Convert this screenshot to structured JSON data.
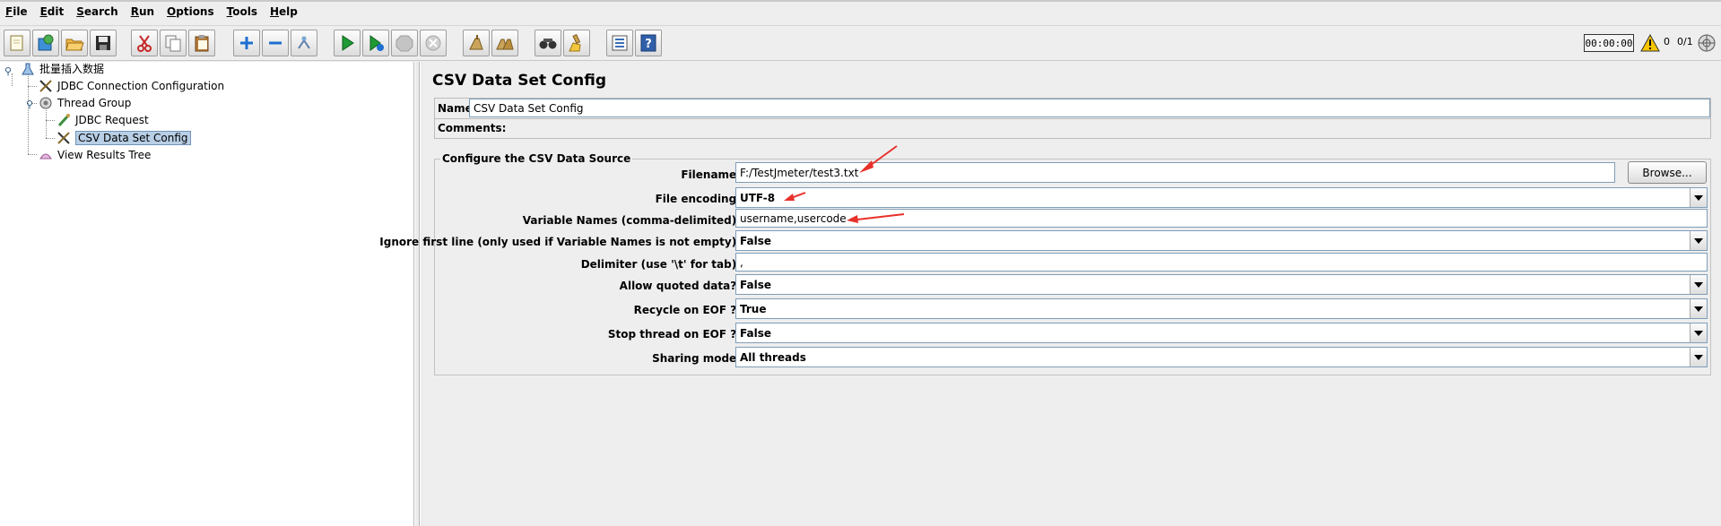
{
  "menu": {
    "items": [
      {
        "mnemonic": "F",
        "rest": "ile"
      },
      {
        "mnemonic": "E",
        "rest": "dit"
      },
      {
        "mnemonic": "S",
        "rest": "earch"
      },
      {
        "mnemonic": "R",
        "rest": "un"
      },
      {
        "mnemonic": "O",
        "rest": "ptions"
      },
      {
        "mnemonic": "T",
        "rest": "ools"
      },
      {
        "mnemonic": "H",
        "rest": "elp"
      }
    ]
  },
  "toolbar": {
    "icons": [
      "new-icon",
      "templates-icon",
      "open-icon",
      "save-icon",
      "cut-icon",
      "copy-icon",
      "paste-icon",
      "expand-icon",
      "collapse-icon",
      "toggle-icon",
      "start-icon",
      "start-no-pauses-icon",
      "stop-icon",
      "shutdown-icon",
      "clear-icon",
      "clear-all-icon",
      "search-icon",
      "reset-search-icon",
      "function-helper-icon",
      "help-icon"
    ],
    "timer": "00:00:00",
    "error_count": "0",
    "thread_count": "0/1"
  },
  "tree": {
    "root": "批量插入数据",
    "jdbc_config": "JDBC Connection Configuration",
    "thread_group": "Thread Group",
    "jdbc_request": "JDBC Request",
    "csv_config": "CSV Data Set Config",
    "view_results": "View Results Tree"
  },
  "panel": {
    "title": "CSV Data Set Config",
    "name_label": "Name:",
    "name_value": "CSV Data Set Config",
    "comments_label": "Comments:",
    "section_title": "Configure the CSV Data Source",
    "filename_label": "Filename:",
    "filename_value": "F:/TestJmeter/test3.txt",
    "browse_label": "Browse...",
    "encoding_label": "File encoding:",
    "encoding_value": "UTF-8",
    "varnames_label": "Variable Names (comma-delimited):",
    "varnames_value": "username,usercode",
    "ignore_label": "Ignore first line (only used if Variable Names is not empty):",
    "ignore_value": "False",
    "delimiter_label": "Delimiter (use '\\t' for tab):",
    "delimiter_value": ",",
    "quoted_label": "Allow quoted data?:",
    "quoted_value": "False",
    "recycle_label": "Recycle on EOF ?:",
    "recycle_value": "True",
    "stop_label": "Stop thread on EOF ?:",
    "stop_value": "False",
    "sharing_label": "Sharing mode:",
    "sharing_value": "All threads"
  },
  "colors": {
    "annotation_arrow": "#e8312b",
    "selection": "#b8cfe5"
  }
}
